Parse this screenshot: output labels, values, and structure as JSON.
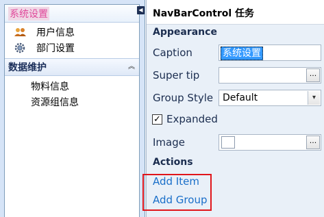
{
  "navbar": {
    "groups": [
      {
        "caption": "系统设置",
        "items": [
          {
            "label": "用户信息",
            "icon": "users-icon"
          },
          {
            "label": "部门设置",
            "icon": "gear-icon"
          }
        ]
      },
      {
        "caption": "数据维护",
        "items": [
          {
            "label": "物料信息"
          },
          {
            "label": "资源组信息"
          }
        ]
      }
    ]
  },
  "tasks": {
    "title": "NavBarControl 任务",
    "appearance_header": "Appearance",
    "caption_label": "Caption",
    "caption_value": "系统设置",
    "supertip_label": "Super tip",
    "supertip_value": "",
    "group_style_label": "Group Style",
    "group_style_value": "Default",
    "expanded_label": "Expanded",
    "expanded_checked": true,
    "image_label": "Image",
    "ellipsis": "...",
    "actions_header": "Actions",
    "add_item": "Add Item",
    "add_group": "Add Group"
  },
  "colors": {
    "highlight_box": "#e0151b",
    "link": "#1a6fc9",
    "selection": "#3399ff"
  }
}
